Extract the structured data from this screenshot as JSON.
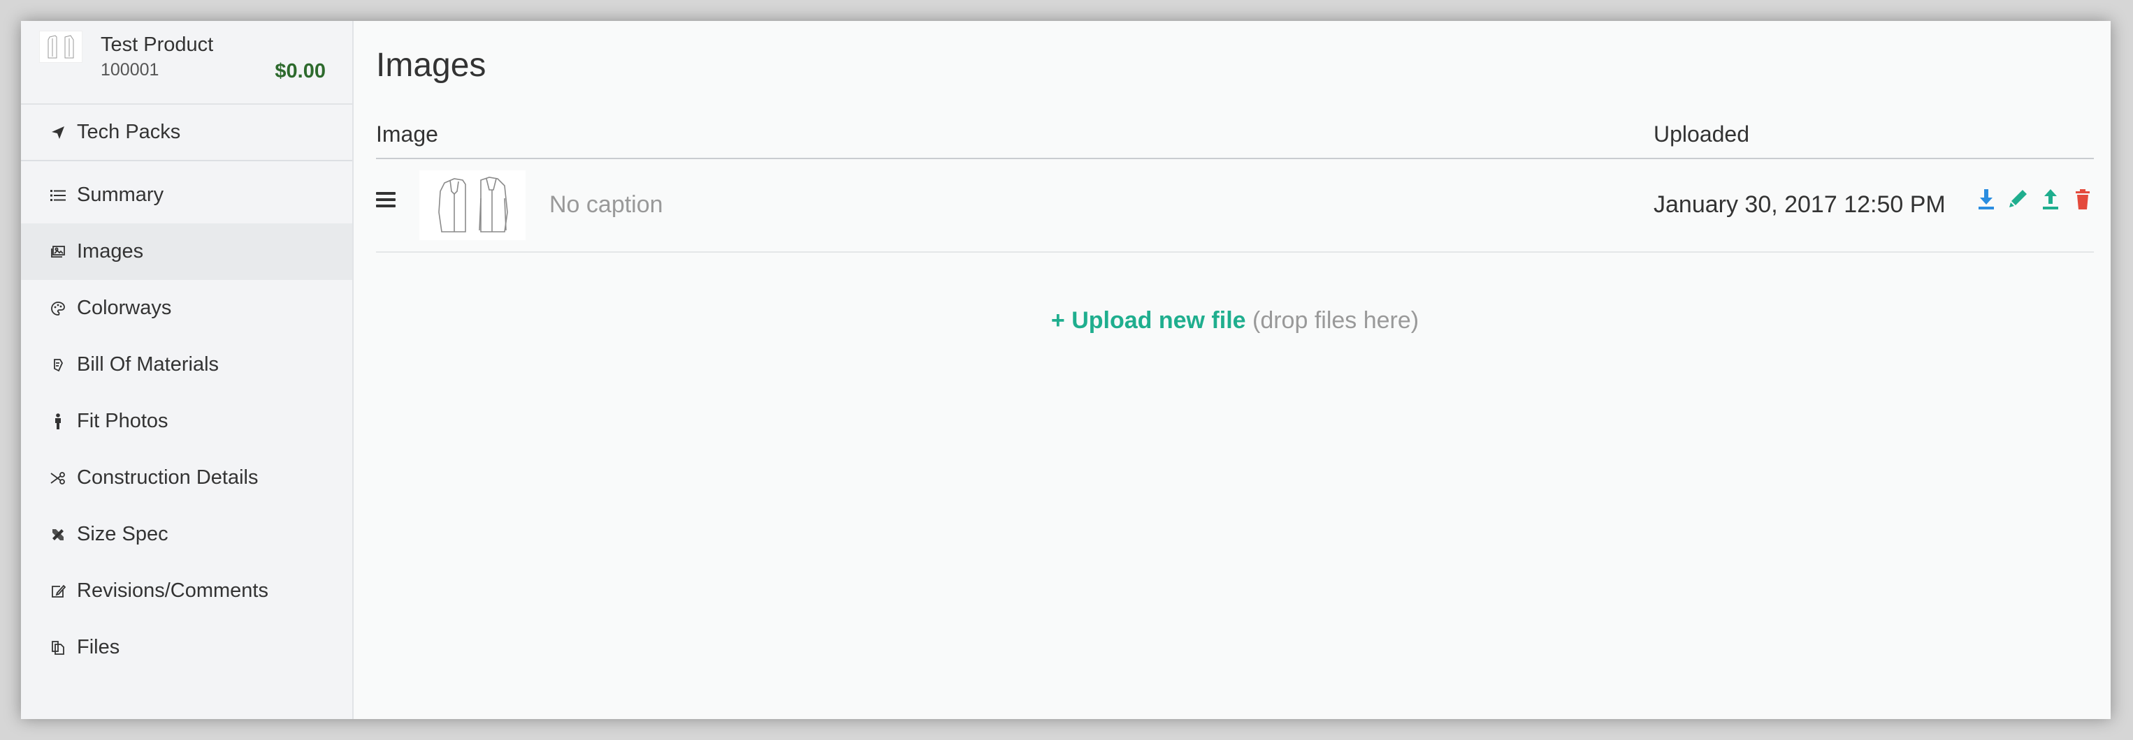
{
  "product": {
    "name": "Test Product",
    "sku": "100001",
    "price": "$0.00"
  },
  "nav": {
    "top": {
      "label": "Tech Packs",
      "icon": "paper-plane-icon"
    },
    "items": [
      {
        "label": "Summary",
        "icon": "list-icon"
      },
      {
        "label": "Images",
        "icon": "image-icon",
        "active": true
      },
      {
        "label": "Colorways",
        "icon": "palette-icon"
      },
      {
        "label": "Bill Of Materials",
        "icon": "materials-icon"
      },
      {
        "label": "Fit Photos",
        "icon": "person-icon"
      },
      {
        "label": "Construction Details",
        "icon": "scissors-icon"
      },
      {
        "label": "Size Spec",
        "icon": "ruler-pencil-icon"
      },
      {
        "label": "Revisions/Comments",
        "icon": "edit-icon"
      },
      {
        "label": "Files",
        "icon": "files-icon"
      }
    ]
  },
  "page": {
    "title": "Images"
  },
  "table": {
    "headers": {
      "image": "Image",
      "uploaded": "Uploaded"
    },
    "rows": [
      {
        "caption": "No caption",
        "uploaded": "January 30, 2017 12:50 PM"
      }
    ]
  },
  "upload": {
    "link": "Upload new file",
    "hint": "(drop files here)",
    "plus": "+"
  },
  "colors": {
    "accent": "#1fae8e",
    "price": "#2d6a2d",
    "download": "#2a8de0",
    "delete": "#e44a3c"
  }
}
